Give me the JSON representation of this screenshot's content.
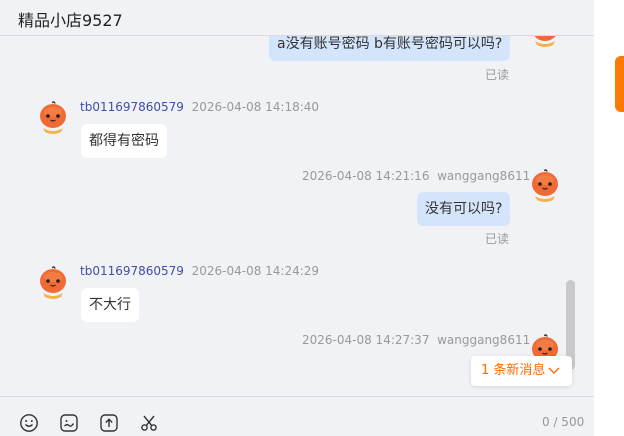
{
  "header": {
    "title": "精品小店9527"
  },
  "messages": [
    {
      "text": "a没有账号密码  b有账号密码可以吗?",
      "status": "已读"
    },
    {
      "nick": "tb011697860579",
      "time": "2026-04-08 14:18:40",
      "text": "都得有密码"
    },
    {
      "time": "2026-04-08 14:21:16",
      "nick": "wanggang8611",
      "text": "没有可以吗?",
      "status": "已读"
    },
    {
      "nick": "tb011697860579",
      "time": "2026-04-08 14:24:29",
      "text": "不大行"
    },
    {
      "time": "2026-04-08 14:27:37",
      "nick": "wanggang8611"
    }
  ],
  "new_messages": {
    "label": "1 条新消息"
  },
  "input": {
    "counter": "0 / 500"
  },
  "toolbar": {
    "icons": [
      "emoji-icon",
      "sticker-icon",
      "upload-icon",
      "scissors-icon"
    ]
  },
  "colors": {
    "accent": "#ff6a00",
    "my_bubble": "#d4e5fb",
    "nick": "#3f4ea6",
    "avatar": "#f06a35"
  }
}
